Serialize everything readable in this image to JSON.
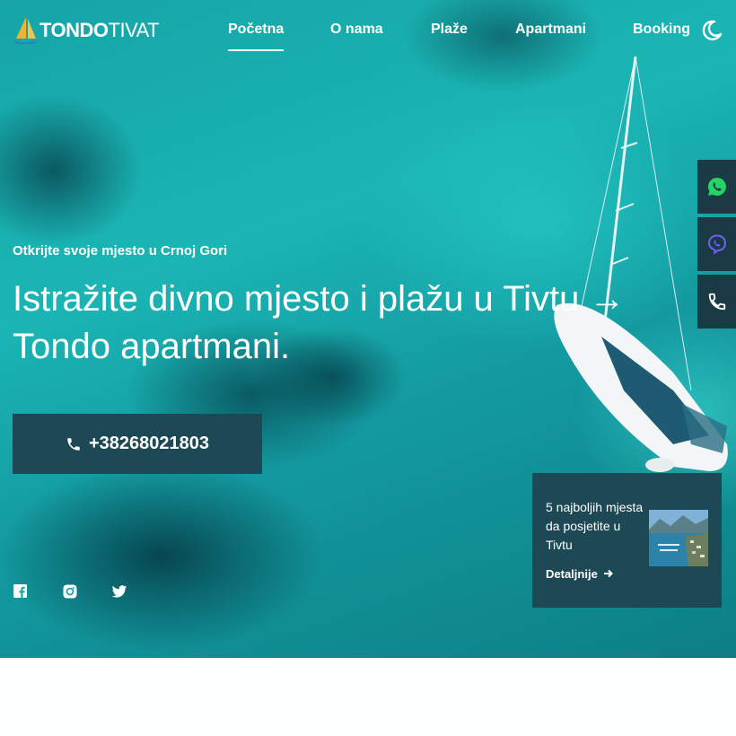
{
  "brand": {
    "name_bold": "TONDO",
    "name_rest": "TIVAT"
  },
  "nav": {
    "items": [
      {
        "label": "Početna",
        "active": true
      },
      {
        "label": "O nama",
        "active": false
      },
      {
        "label": "Plaže",
        "active": false
      },
      {
        "label": "Apartmani",
        "active": false
      },
      {
        "label": "Booking",
        "active": false
      }
    ],
    "theme_icon": "moon-icon"
  },
  "hero": {
    "subtitle": "Otkrijte svoje mjesto u Crnoj Gori",
    "headline": "Istražite divno mjesto i plažu u Tivtu → Tondo apartmani.",
    "phone_label": "+38268021803",
    "phone_icon": "phone-icon"
  },
  "socials": [
    "facebook-icon",
    "instagram-icon",
    "twitter-icon"
  ],
  "side_contacts": [
    {
      "icon": "whatsapp-icon",
      "color": "#25d366"
    },
    {
      "icon": "viber-icon",
      "color": "#7360f2"
    },
    {
      "icon": "phone-icon",
      "color": "#ffffff"
    }
  ],
  "promo_card": {
    "title": "5 najboljih mjesta da posjetite u Tivtu",
    "link_label": "Detaljnije",
    "link_icon": "arrow-right-icon"
  },
  "colors": {
    "dark_panel": "#1d4955",
    "side_panel": "#1b3b44",
    "sea": "#17a9aa"
  }
}
